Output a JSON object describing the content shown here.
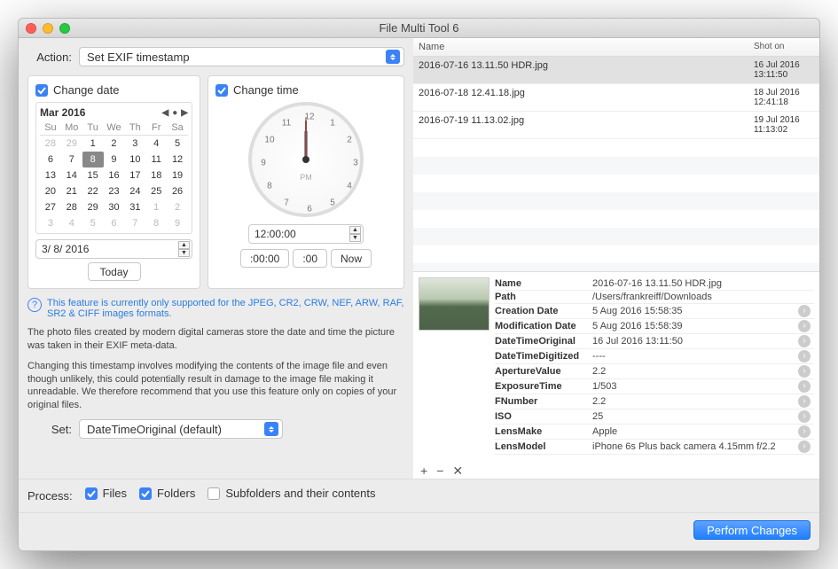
{
  "window": {
    "title": "File Multi Tool 6"
  },
  "action": {
    "label": "Action:",
    "value": "Set EXIF timestamp"
  },
  "date_panel": {
    "checkbox_label": "Change date",
    "month_label": "Mar 2016",
    "day_headers": [
      "Su",
      "Mo",
      "Tu",
      "We",
      "Th",
      "Fr",
      "Sa"
    ],
    "leading_mute": [
      "28",
      "29"
    ],
    "days": [
      "1",
      "2",
      "3",
      "4",
      "5",
      "6",
      "7",
      "8",
      "9",
      "10",
      "11",
      "12",
      "13",
      "14",
      "15",
      "16",
      "17",
      "18",
      "19",
      "20",
      "21",
      "22",
      "23",
      "24",
      "25",
      "26",
      "27",
      "28",
      "29",
      "30",
      "31"
    ],
    "trailing_mute": [
      "1",
      "2",
      "3",
      "4",
      "5",
      "6",
      "7",
      "8",
      "9"
    ],
    "selected_day": "8",
    "date_value": "3/  8/ 2016",
    "today_btn": "Today"
  },
  "time_panel": {
    "checkbox_label": "Change time",
    "pm_label": "PM",
    "numbers": [
      "12",
      "1",
      "2",
      "3",
      "4",
      "5",
      "6",
      "7",
      "8",
      "9",
      "10",
      "11"
    ],
    "time_value": "12:00:00",
    "btn_zero_min": ":00:00",
    "btn_zero_sec": ":00",
    "btn_now": "Now"
  },
  "help": {
    "highlighted": "This feature is currently only supported for the JPEG, CR2, CRW, NEF, ARW, RAF, SR2 & CIFF images formats.",
    "p1": "The photo files created by modern digital cameras store the date and time the picture was taken in their EXIF meta-data.",
    "p2": "Changing this timestamp involves modifying the contents of the image file and even though unlikely, this could potentially result in damage to the image file making it unreadable. We therefore recommend that you use this feature only on copies of your original files."
  },
  "set": {
    "label": "Set:",
    "value": "DateTimeOriginal (default)"
  },
  "process": {
    "label": "Process:",
    "files": "Files",
    "folders": "Folders",
    "subfolders": "Subfolders and their contents"
  },
  "filelist": {
    "col_name": "Name",
    "col_shot": "Shot on",
    "rows": [
      {
        "name": "2016-07-16 13.11.50 HDR.jpg",
        "shot": "16 Jul 2016 13:11:50",
        "selected": true
      },
      {
        "name": "2016-07-18 12.41.18.jpg",
        "shot": "18 Jul 2016 12:41:18",
        "selected": false
      },
      {
        "name": "2016-07-19 11.13.02.jpg",
        "shot": "19 Jul 2016 11:13:02",
        "selected": false
      }
    ]
  },
  "detail": {
    "props": [
      {
        "k": "Name",
        "v": "2016-07-16 13.11.50 HDR.jpg",
        "go": false
      },
      {
        "k": "Path",
        "v": "/Users/frankreiff/Downloads",
        "go": false
      },
      {
        "k": "Creation Date",
        "v": "5 Aug 2016 15:58:35",
        "go": true
      },
      {
        "k": "Modification Date",
        "v": "5 Aug 2016 15:58:39",
        "go": true
      },
      {
        "k": "DateTimeOriginal",
        "v": "16 Jul 2016 13:11:50",
        "go": true
      },
      {
        "k": "DateTimeDigitized",
        "v": "----",
        "go": true
      },
      {
        "k": "ApertureValue",
        "v": "2.2",
        "go": true
      },
      {
        "k": "ExposureTime",
        "v": "1/503",
        "go": true
      },
      {
        "k": "FNumber",
        "v": "2.2",
        "go": true
      },
      {
        "k": "ISO",
        "v": "25",
        "go": true
      },
      {
        "k": "LensMake",
        "v": "Apple",
        "go": true
      },
      {
        "k": "LensModel",
        "v": "iPhone 6s Plus back camera 4.15mm f/2.2",
        "go": true
      }
    ]
  },
  "footer": {
    "perform": "Perform Changes"
  },
  "icons": {
    "add": "+",
    "remove": "−",
    "close": "✕"
  }
}
